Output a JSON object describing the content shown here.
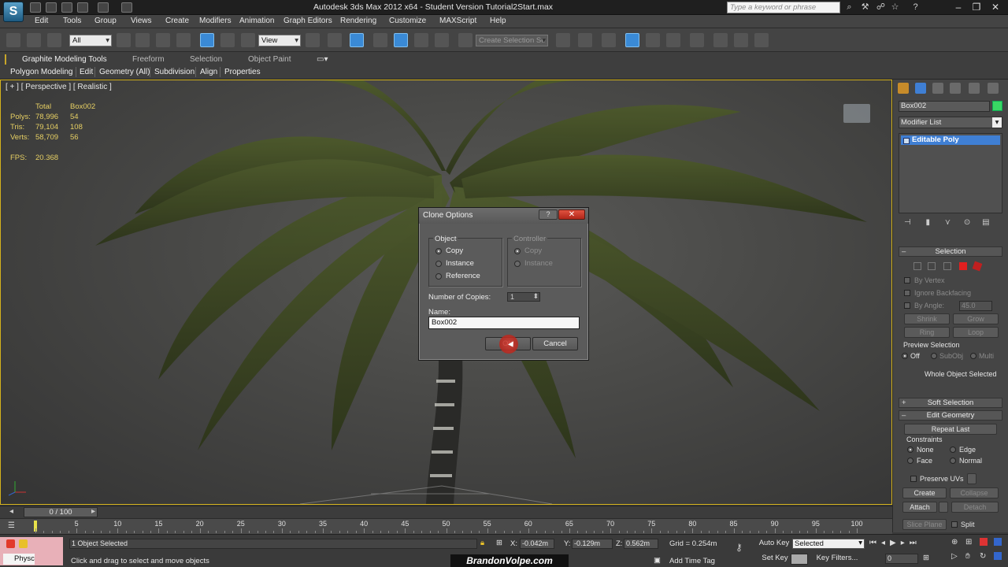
{
  "window": {
    "title": "Autodesk 3ds Max  2012 x64   -  Student Version     Tutorial2Start.max",
    "search_placeholder": "Type a keyword or phrase",
    "logo": "S"
  },
  "menu": [
    "Edit",
    "Tools",
    "Group",
    "Views",
    "Create",
    "Modifiers",
    "Animation",
    "Graph Editors",
    "Rendering",
    "Customize",
    "MAXScript",
    "Help"
  ],
  "toolbar": {
    "selection_filter": "All",
    "ref_coord": "View",
    "named_selection": "Create Selection Se"
  },
  "ribbon": {
    "tabs": [
      "Graphite Modeling Tools",
      "Freeform",
      "Selection",
      "Object Paint"
    ],
    "subtabs": [
      "Polygon Modeling",
      "Edit",
      "Geometry (All)",
      "Subdivision",
      "Align",
      "Properties"
    ]
  },
  "viewport": {
    "label": "[ + ] [ Perspective ] [ Realistic ]",
    "stats": {
      "header": [
        "",
        "Total",
        "Box002"
      ],
      "rows": [
        [
          "Polys:",
          "78,996",
          "54"
        ],
        [
          "Tris:",
          "79,104",
          "108"
        ],
        [
          "Verts:",
          "58,709",
          "56"
        ]
      ],
      "fps_label": "FPS:",
      "fps_value": "20.368"
    }
  },
  "dialog": {
    "title": "Clone Options",
    "help": "?",
    "close": "✕",
    "object_group": "Object",
    "object_options": [
      "Copy",
      "Instance",
      "Reference"
    ],
    "controller_group": "Controller",
    "controller_options": [
      "Copy",
      "Instance"
    ],
    "copies_label": "Number of Copies:",
    "copies_value": "1",
    "name_label": "Name:",
    "name_value": "Box002",
    "ok": "OK",
    "cancel": "Cancel"
  },
  "command_panel": {
    "object_name": "Box002",
    "object_color": "#39d864",
    "modifier_list": "Modifier List",
    "stack_item": "Editable Poly",
    "selection": {
      "title": "Selection",
      "by_vertex": "By Vertex",
      "ignore_backfacing": "Ignore Backfacing",
      "by_angle": "By Angle:",
      "angle_value": "45.0",
      "shrink": "Shrink",
      "grow": "Grow",
      "ring": "Ring",
      "loop": "Loop",
      "preview_label": "Preview Selection",
      "preview_off": "Off",
      "preview_subobj": "SubObj",
      "preview_multi": "Multi",
      "whole_object": "Whole Object Selected"
    },
    "soft_selection": "Soft Selection",
    "edit_geometry": "Edit Geometry",
    "repeat_last": "Repeat Last",
    "constraints_label": "Constraints",
    "constraints": [
      "None",
      "Edge",
      "Face",
      "Normal"
    ],
    "preserve_uvs": "Preserve UVs",
    "create": "Create",
    "collapse": "Collapse",
    "attach": "Attach",
    "detach": "Detach",
    "slice_plane": "Slice Plane",
    "split": "Split"
  },
  "timeline": {
    "slider": "0 / 100",
    "ticks": [
      "0",
      "5",
      "10",
      "15",
      "20",
      "25",
      "30",
      "35",
      "40",
      "45",
      "50",
      "55",
      "60",
      "65",
      "70",
      "75",
      "80",
      "85",
      "90",
      "95",
      "100"
    ]
  },
  "status": {
    "maxscript_label": "Physc",
    "selection_status": "1 Object Selected",
    "prompt": "Click and drag to select and move objects",
    "x_label": "X:",
    "x_value": "-0.042m",
    "y_label": "Y:",
    "y_value": "-0.129m",
    "z_label": "Z:",
    "z_value": "0.562m",
    "grid": "Grid = 0.254m",
    "add_time_tag": "Add Time Tag",
    "auto_key": "Auto Key",
    "set_key": "Set Key",
    "key_mode": "Selected",
    "key_filters": "Key Filters...",
    "frame": "0",
    "watermark": "BrandonVolpe.com"
  }
}
